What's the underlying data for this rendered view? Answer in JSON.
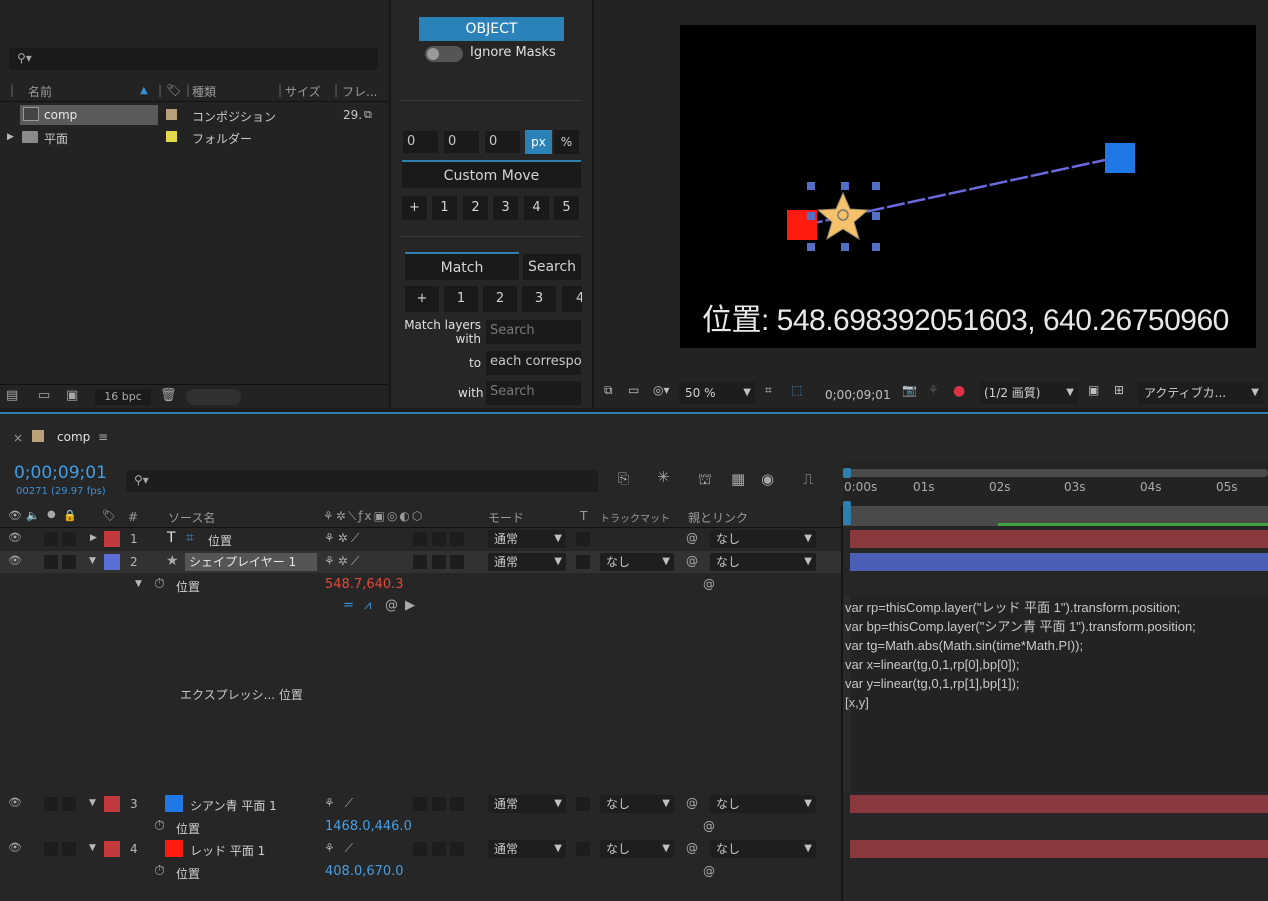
{
  "project": {
    "columns": {
      "name": "名前",
      "type": "種類",
      "size": "サイズ",
      "frame": "フレ..."
    },
    "items": [
      {
        "name": "comp",
        "type": "コンポジション",
        "size": "29.",
        "color": "#b8a07a"
      },
      {
        "name": "平面",
        "type": "フォルダー",
        "size": "",
        "color": "#e5d84a"
      }
    ],
    "bpc": "16 bpc"
  },
  "tool": {
    "object_tab": "OBJECT",
    "ignore_masks": "Ignore Masks",
    "xyz": [
      "0",
      "0",
      "0"
    ],
    "unit_px": "px",
    "unit_pct": "%",
    "custom_move": "Custom Move",
    "move_buttons": [
      "+",
      "1",
      "2",
      "3",
      "4",
      "5"
    ],
    "match_tab": "Match",
    "search_tab": "Search",
    "match_buttons": [
      "+",
      "1",
      "2",
      "3",
      "4"
    ],
    "match_layers_label": "Match layers with",
    "match_layers_placeholder": "Search",
    "to_label": "to",
    "to_value": "each correspon",
    "with_label": "with",
    "with_placeholder": "Search"
  },
  "viewer": {
    "overlay_text": "位置: 548.698392051603, 640.26750960",
    "zoom": "50 %",
    "timecode": "0;00;09;01",
    "quality": "(1/2 画質)",
    "camera": "アクティブカ...",
    "colors": {
      "red": "#ff1b10",
      "blue": "#1f78e6",
      "star": "#f5c26b",
      "path": "#6a6adf",
      "handle": "#5470c6"
    }
  },
  "timeline": {
    "comp_name": "comp",
    "timecode": "0;00;09;01",
    "frame_info": "00271 (29.97 fps)",
    "headers": {
      "num": "#",
      "source": "ソース名",
      "mode": "モード",
      "t": "T",
      "trackmatte": "トラックマット",
      "parent": "親とリンク"
    },
    "ruler": [
      "0:00s",
      "01s",
      "02s",
      "03s",
      "04s",
      "05s"
    ],
    "layers": [
      {
        "num": "1",
        "name": "位置",
        "type": "text",
        "mode": "通常",
        "parent": "なし",
        "label_color": "#c43a3a"
      },
      {
        "num": "2",
        "name": "シェイプレイヤー 1",
        "type": "shape",
        "mode": "通常",
        "matte": "なし",
        "parent": "なし",
        "label_color": "#5a6fd6"
      },
      {
        "num": "3",
        "name": "シアン青 平面 1",
        "type": "solid",
        "mode": "通常",
        "matte": "なし",
        "parent": "なし",
        "label_color": "#c43a3a",
        "swatch": "#1f78e6"
      },
      {
        "num": "4",
        "name": "レッド 平面 1",
        "type": "solid",
        "mode": "通常",
        "matte": "なし",
        "parent": "なし",
        "label_color": "#c43a3a",
        "swatch": "#ff1b10"
      }
    ],
    "prop_position": "位置",
    "layer2_position": "548.7,640.3",
    "layer3_position": "1468.0,446.0",
    "layer4_position": "408.0,670.0",
    "expression_label": "エクスプレッシ... 位置",
    "expression": [
      "var rp=thisComp.layer(\"レッド 平面 1\").transform.position;",
      "var bp=thisComp.layer(\"シアン青 平面 1\").transform.position;",
      "var tg=Math.abs(Math.sin(time*Math.PI));",
      "var x=linear(tg,0,1,rp[0],bp[0]);",
      "var y=linear(tg,0,1,rp[1],bp[1]);",
      "[x,y]"
    ],
    "bar_colors": {
      "red": "#8a3a3e",
      "blue": "#4a5fb5",
      "work": "#3fa33f"
    }
  }
}
